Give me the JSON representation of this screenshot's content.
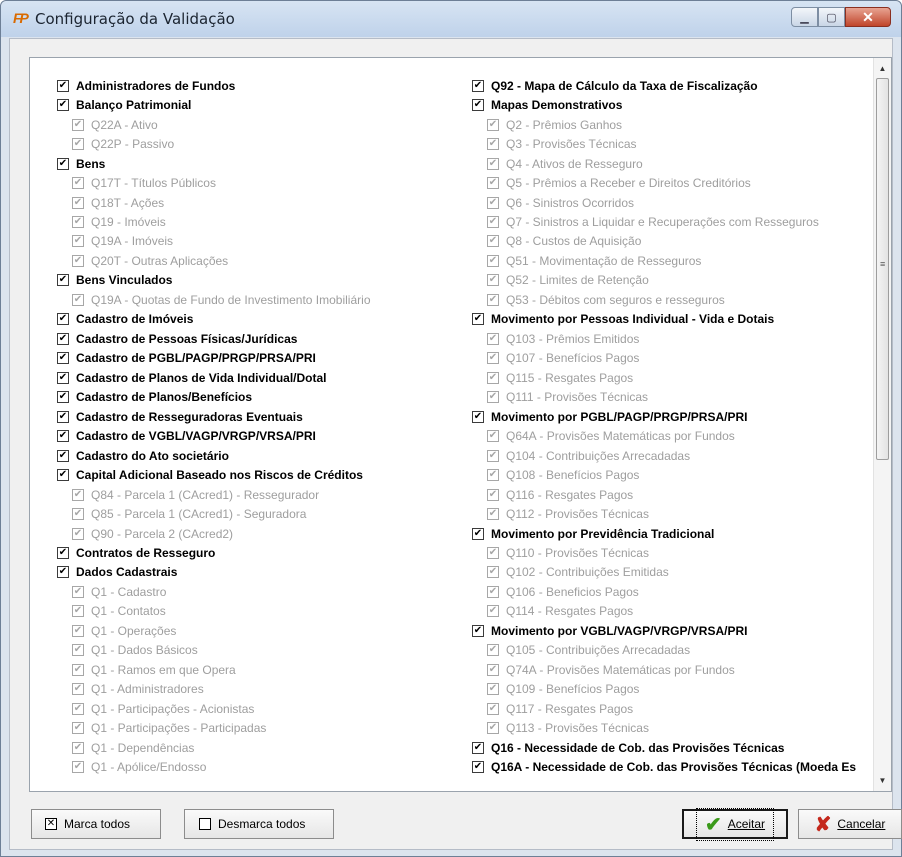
{
  "window": {
    "title": "Configuração da Validação",
    "app_icon_text": "FP"
  },
  "left_items": [
    {
      "label": "Administradores de Fundos",
      "level": 0,
      "checked": true
    },
    {
      "label": "Balanço Patrimonial",
      "level": 0,
      "checked": true
    },
    {
      "label": "Q22A - Ativo",
      "level": 1,
      "checked": true
    },
    {
      "label": "Q22P - Passivo",
      "level": 1,
      "checked": true
    },
    {
      "label": "Bens",
      "level": 0,
      "checked": true
    },
    {
      "label": "Q17T - Títulos Públicos",
      "level": 1,
      "checked": true
    },
    {
      "label": "Q18T - Ações",
      "level": 1,
      "checked": true
    },
    {
      "label": "Q19 - Imóveis",
      "level": 1,
      "checked": true
    },
    {
      "label": "Q19A - Imóveis",
      "level": 1,
      "checked": true
    },
    {
      "label": "Q20T - Outras Aplicações",
      "level": 1,
      "checked": true
    },
    {
      "label": "Bens Vinculados",
      "level": 0,
      "checked": true
    },
    {
      "label": "Q19A - Quotas de Fundo de Investimento Imobiliário",
      "level": 1,
      "checked": true
    },
    {
      "label": "Cadastro de Imóveis",
      "level": 0,
      "checked": true
    },
    {
      "label": "Cadastro de Pessoas Físicas/Jurídicas",
      "level": 0,
      "checked": true
    },
    {
      "label": "Cadastro de PGBL/PAGP/PRGP/PRSA/PRI",
      "level": 0,
      "checked": true
    },
    {
      "label": "Cadastro de Planos de Vida Individual/Dotal",
      "level": 0,
      "checked": true
    },
    {
      "label": "Cadastro de Planos/Benefícios",
      "level": 0,
      "checked": true
    },
    {
      "label": "Cadastro de Resseguradoras Eventuais",
      "level": 0,
      "checked": true
    },
    {
      "label": "Cadastro de VGBL/VAGP/VRGP/VRSA/PRI",
      "level": 0,
      "checked": true
    },
    {
      "label": "Cadastro do Ato societário",
      "level": 0,
      "checked": true
    },
    {
      "label": "Capital Adicional Baseado nos Riscos de Créditos",
      "level": 0,
      "checked": true
    },
    {
      "label": "Q84 - Parcela 1 (CAcred1) - Ressegurador",
      "level": 1,
      "checked": true
    },
    {
      "label": "Q85 - Parcela 1 (CAcred1) - Seguradora",
      "level": 1,
      "checked": true
    },
    {
      "label": "Q90 - Parcela 2 (CAcred2)",
      "level": 1,
      "checked": true
    },
    {
      "label": "Contratos de Resseguro",
      "level": 0,
      "checked": true
    },
    {
      "label": "Dados Cadastrais",
      "level": 0,
      "checked": true
    },
    {
      "label": "Q1 - Cadastro",
      "level": 1,
      "checked": true
    },
    {
      "label": "Q1 - Contatos",
      "level": 1,
      "checked": true
    },
    {
      "label": "Q1 - Operações",
      "level": 1,
      "checked": true
    },
    {
      "label": "Q1 - Dados Básicos",
      "level": 1,
      "checked": true
    },
    {
      "label": "Q1 - Ramos em que Opera",
      "level": 1,
      "checked": true
    },
    {
      "label": "Q1 - Administradores",
      "level": 1,
      "checked": true
    },
    {
      "label": "Q1 - Participações - Acionistas",
      "level": 1,
      "checked": true
    },
    {
      "label": "Q1 - Participações - Participadas",
      "level": 1,
      "checked": true
    },
    {
      "label": "Q1 - Dependências",
      "level": 1,
      "checked": true
    },
    {
      "label": "Q1 - Apólice/Endosso",
      "level": 1,
      "checked": true
    }
  ],
  "right_items": [
    {
      "label": "Q92 - Mapa de Cálculo da Taxa de Fiscalização",
      "level": 0,
      "checked": true
    },
    {
      "label": "Mapas Demonstrativos",
      "level": 0,
      "checked": true
    },
    {
      "label": "Q2 - Prêmios Ganhos",
      "level": 1,
      "checked": true
    },
    {
      "label": "Q3 - Provisões Técnicas",
      "level": 1,
      "checked": true
    },
    {
      "label": "Q4 - Ativos de Resseguro",
      "level": 1,
      "checked": true
    },
    {
      "label": "Q5 - Prêmios a Receber e Direitos Creditórios",
      "level": 1,
      "checked": true
    },
    {
      "label": "Q6 - Sinistros Ocorridos",
      "level": 1,
      "checked": true
    },
    {
      "label": "Q7 - Sinistros a Liquidar e Recuperações com Resseguros",
      "level": 1,
      "checked": true
    },
    {
      "label": "Q8 - Custos de Aquisição",
      "level": 1,
      "checked": true
    },
    {
      "label": "Q51 - Movimentação de Resseguros",
      "level": 1,
      "checked": true
    },
    {
      "label": "Q52 - Limites de Retenção",
      "level": 1,
      "checked": true
    },
    {
      "label": "Q53 - Débitos com seguros e resseguros",
      "level": 1,
      "checked": true
    },
    {
      "label": "Movimento por Pessoas Individual - Vida e Dotais",
      "level": 0,
      "checked": true
    },
    {
      "label": "Q103 - Prêmios Emitidos",
      "level": 1,
      "checked": true
    },
    {
      "label": "Q107 - Benefícios Pagos",
      "level": 1,
      "checked": true
    },
    {
      "label": "Q115 - Resgates Pagos",
      "level": 1,
      "checked": true
    },
    {
      "label": "Q111 - Provisões Técnicas",
      "level": 1,
      "checked": true
    },
    {
      "label": "Movimento por PGBL/PAGP/PRGP/PRSA/PRI",
      "level": 0,
      "checked": true
    },
    {
      "label": "Q64A - Provisões Matemáticas por Fundos",
      "level": 1,
      "checked": true
    },
    {
      "label": "Q104 - Contribuições Arrecadadas",
      "level": 1,
      "checked": true
    },
    {
      "label": "Q108 - Benefícios Pagos",
      "level": 1,
      "checked": true
    },
    {
      "label": "Q116 - Resgates Pagos",
      "level": 1,
      "checked": true
    },
    {
      "label": "Q112 - Provisões Técnicas",
      "level": 1,
      "checked": true
    },
    {
      "label": "Movimento por Previdência Tradicional",
      "level": 0,
      "checked": true
    },
    {
      "label": "Q110 - Provisões Técnicas",
      "level": 1,
      "checked": true
    },
    {
      "label": "Q102 - Contribuições Emitidas",
      "level": 1,
      "checked": true
    },
    {
      "label": "Q106 - Beneficios Pagos",
      "level": 1,
      "checked": true
    },
    {
      "label": "Q114 - Resgates Pagos",
      "level": 1,
      "checked": true
    },
    {
      "label": "Movimento por VGBL/VAGP/VRGP/VRSA/PRI",
      "level": 0,
      "checked": true
    },
    {
      "label": "Q105 - Contribuições Arrecadadas",
      "level": 1,
      "checked": true
    },
    {
      "label": "Q74A - Provisões Matemáticas por Fundos",
      "level": 1,
      "checked": true
    },
    {
      "label": "Q109 - Benefícios Pagos",
      "level": 1,
      "checked": true
    },
    {
      "label": "Q117 - Resgates Pagos",
      "level": 1,
      "checked": true
    },
    {
      "label": "Q113 - Provisões Técnicas",
      "level": 1,
      "checked": true
    },
    {
      "label": "Q16 - Necessidade de Cob. das Provisões Técnicas",
      "level": 0,
      "checked": true,
      "bold": true
    },
    {
      "label": "Q16A - Necessidade de Cob. das Provisões Técnicas (Moeda Es",
      "level": 0,
      "checked": true,
      "bold": true
    }
  ],
  "buttons": {
    "mark_all": "Marca todos",
    "unmark_all": "Desmarca todos",
    "accept": "Aceitar",
    "cancel": "Cancelar"
  },
  "icons": {
    "check_glyph": "✔",
    "ok_icon": "check-icon",
    "cancel_icon": "cross-icon"
  }
}
